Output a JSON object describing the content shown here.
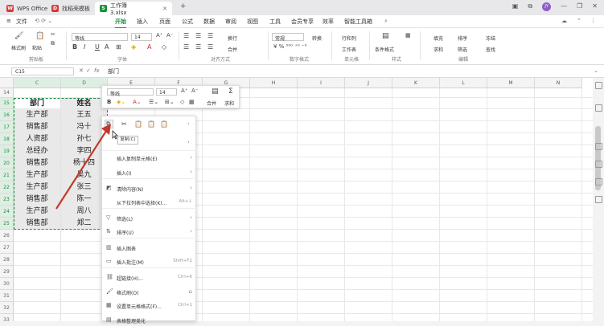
{
  "titlebar": {
    "tabs": [
      {
        "label": "WPS Office",
        "logo_color": "#d63a3a"
      },
      {
        "label": "找稻壳模板",
        "logo_color": "#d63a3a"
      },
      {
        "label": "工作簿3.xlsx",
        "logo_color": "#1a8f3c"
      }
    ],
    "new_tab": "+",
    "avatar": "JY"
  },
  "menubar": {
    "hamburger": "≡",
    "file": "文件",
    "items": [
      "开始",
      "插入",
      "页面",
      "公式",
      "数据",
      "审阅",
      "视图",
      "工具",
      "会员专享",
      "效率",
      "智能工具箱"
    ],
    "active": "开始"
  },
  "ribbon": {
    "format_painter": "格式刷",
    "paste": "粘贴",
    "clipboard_group": "剪贴板",
    "font_name": "等线",
    "font_size": "14",
    "font_group": "字体",
    "wrap": "换行",
    "merge": "合并",
    "align_group": "对齐方式",
    "number_format": "常规",
    "convert": "转换",
    "number_group": "数字格式",
    "rows_cols": "行和列",
    "worksheet": "工作表",
    "cells_group": "单元格",
    "cond_format": "条件格式",
    "style_group": "样式",
    "fill": "填充",
    "sum": "求和",
    "sort": "排序",
    "filter": "筛选",
    "freeze": "冻结",
    "find": "查找",
    "edit_group": "编辑"
  },
  "formulabar": {
    "cell_ref": "C15",
    "fx": "fx",
    "value": "部门"
  },
  "columns": [
    "C",
    "D",
    "E",
    "F",
    "G",
    "H",
    "I",
    "J",
    "K",
    "L",
    "M",
    "N"
  ],
  "rows": [
    {
      "num": "14",
      "dept": "",
      "name": ""
    },
    {
      "num": "15",
      "dept": "部门",
      "name": "姓名"
    },
    {
      "num": "16",
      "dept": "生产部",
      "name": "王五"
    },
    {
      "num": "17",
      "dept": "销售部",
      "name": "冯十"
    },
    {
      "num": "18",
      "dept": "人资部",
      "name": "孙七"
    },
    {
      "num": "19",
      "dept": "总经办",
      "name": "李四"
    },
    {
      "num": "20",
      "dept": "销售部",
      "name": "杨十四"
    },
    {
      "num": "21",
      "dept": "生产部",
      "name": "吴九"
    },
    {
      "num": "22",
      "dept": "生产部",
      "name": "张三"
    },
    {
      "num": "23",
      "dept": "销售部",
      "name": "陈一"
    },
    {
      "num": "24",
      "dept": "生产部",
      "name": "周八"
    },
    {
      "num": "25",
      "dept": "销售部",
      "name": "郑二"
    },
    {
      "num": "26",
      "dept": "",
      "name": ""
    },
    {
      "num": "27",
      "dept": "",
      "name": ""
    },
    {
      "num": "28",
      "dept": "",
      "name": ""
    },
    {
      "num": "29",
      "dept": "",
      "name": ""
    },
    {
      "num": "30",
      "dept": "",
      "name": ""
    },
    {
      "num": "31",
      "dept": "",
      "name": ""
    },
    {
      "num": "32",
      "dept": "",
      "name": ""
    },
    {
      "num": "33",
      "dept": "",
      "name": ""
    }
  ],
  "mini_toolbar": {
    "font": "等线",
    "size": "14",
    "bold": "B",
    "merge": "合并",
    "sum": "求和"
  },
  "tooltip": "复制(C)",
  "context_menu": [
    {
      "label": "插入复制单元格(E)",
      "shortcut": "",
      "icon": "insert-copy-icon",
      "submenu": true
    },
    {
      "label": "插入(I)",
      "shortcut": "",
      "icon": "insert-icon",
      "submenu": true
    },
    {
      "label": "清除内容(N)",
      "shortcut": "",
      "icon": "eraser-icon",
      "submenu": true
    },
    {
      "label": "从下拉列表中选择(K)...",
      "shortcut": "Alt+↓",
      "icon": "",
      "submenu": false
    },
    {
      "label": "筛选(L)",
      "shortcut": "",
      "icon": "filter-icon",
      "submenu": true
    },
    {
      "label": "排序(U)",
      "shortcut": "",
      "icon": "sort-icon",
      "submenu": true
    },
    {
      "label": "插入图表",
      "shortcut": "",
      "icon": "chart-icon",
      "submenu": false
    },
    {
      "label": "插入批注(M)",
      "shortcut": "Shift+F2",
      "icon": "comment-icon",
      "submenu": false
    },
    {
      "label": "超链接(H)...",
      "shortcut": "Ctrl+K",
      "icon": "link-icon",
      "submenu": false
    },
    {
      "label": "格式刷(O)",
      "shortcut": "",
      "icon": "brush-icon",
      "submenu": false
    },
    {
      "label": "设置单元格格式(F)...",
      "shortcut": "Ctrl+1",
      "icon": "format-cells-icon",
      "submenu": false
    },
    {
      "label": "表格整理美化",
      "shortcut": "",
      "icon": "beautify-icon",
      "submenu": false
    }
  ],
  "accent_color": "#1a8f3c",
  "annotation_arrow_color": "#c0392b"
}
